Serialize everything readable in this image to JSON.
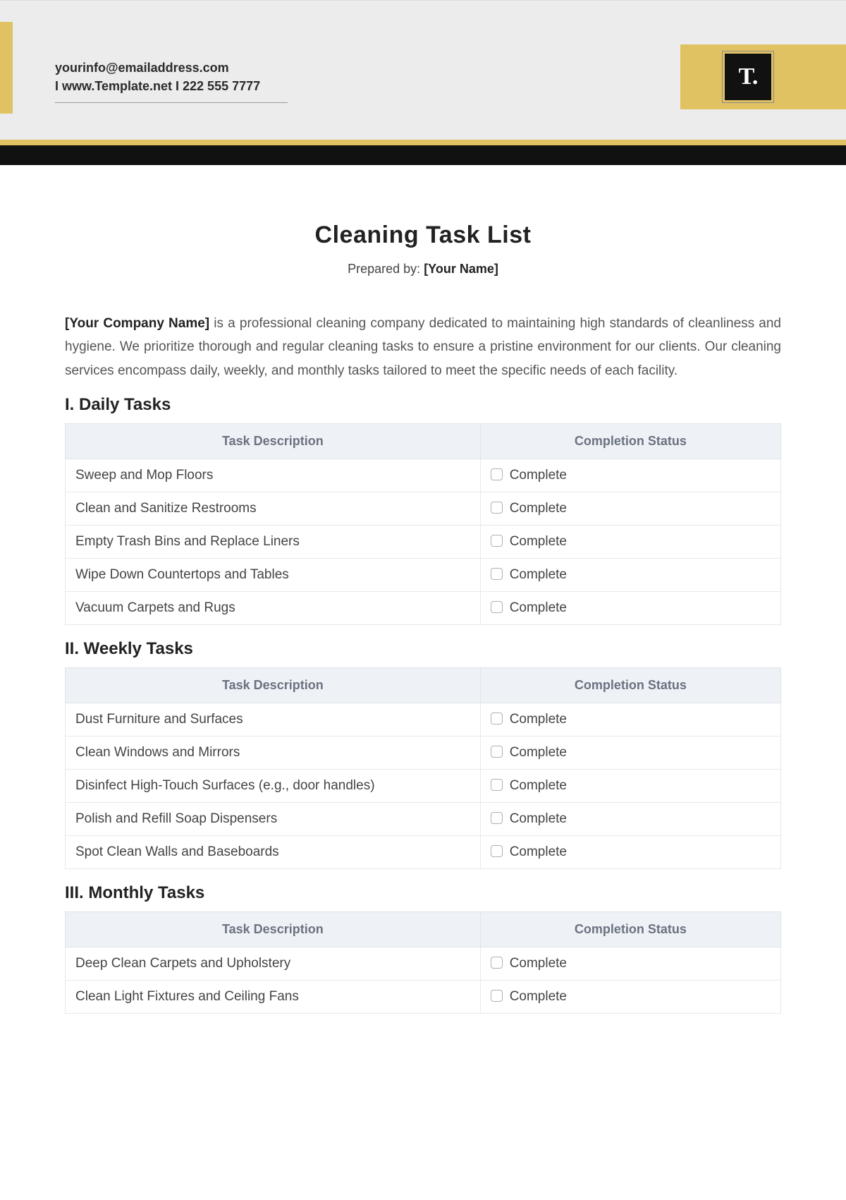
{
  "header": {
    "email": "yourinfo@emailaddress.com",
    "line2": "I  www.Template.net  I  222 555 7777",
    "logo_text": "T."
  },
  "document": {
    "title": "Cleaning Task List",
    "prepared_by_label": "Prepared by:",
    "prepared_by_value": "[Your Name]",
    "intro_bold": "[Your Company Name]",
    "intro_rest": " is a professional cleaning company dedicated to maintaining high standards of cleanliness and hygiene. We prioritize thorough and regular cleaning tasks to ensure a pristine environment for our clients. Our cleaning services encompass daily, weekly, and monthly tasks tailored to meet the specific needs of each facility."
  },
  "columns": {
    "task": "Task Description",
    "status": "Completion Status",
    "complete_label": "Complete"
  },
  "sections": [
    {
      "heading": "I. Daily Tasks",
      "rows": [
        "Sweep and Mop Floors",
        "Clean and Sanitize Restrooms",
        "Empty Trash Bins and Replace Liners",
        "Wipe Down Countertops and Tables",
        "Vacuum Carpets and Rugs"
      ]
    },
    {
      "heading": "II. Weekly Tasks",
      "rows": [
        "Dust Furniture and Surfaces",
        "Clean Windows and Mirrors",
        "Disinfect High-Touch Surfaces (e.g., door handles)",
        "Polish and Refill Soap Dispensers",
        "Spot Clean Walls and Baseboards"
      ]
    },
    {
      "heading": "III. Monthly Tasks",
      "rows": [
        "Deep Clean Carpets and Upholstery",
        "Clean Light Fixtures and Ceiling Fans"
      ]
    }
  ]
}
